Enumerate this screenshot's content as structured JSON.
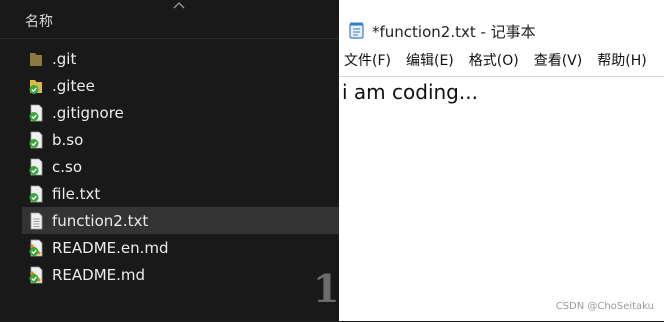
{
  "explorer": {
    "column_header": "名称",
    "files": [
      {
        "name": ".git",
        "icon": "folder-icon"
      },
      {
        "name": ".gitee",
        "icon": "folder-synced-icon"
      },
      {
        "name": ".gitignore",
        "icon": "file-synced-icon"
      },
      {
        "name": "b.so",
        "icon": "file-synced-icon"
      },
      {
        "name": "c.so",
        "icon": "file-synced-icon"
      },
      {
        "name": "file.txt",
        "icon": "file-synced-icon"
      },
      {
        "name": "function2.txt",
        "icon": "text-file-icon",
        "selected": true
      },
      {
        "name": "README.en.md",
        "icon": "markdown-file-icon"
      },
      {
        "name": "README.md",
        "icon": "markdown-file-icon"
      }
    ],
    "partial_text": "1"
  },
  "notepad": {
    "title": "*function2.txt - 记事本",
    "menu": [
      "文件(F)",
      "编辑(E)",
      "格式(O)",
      "查看(V)",
      "帮助(H)"
    ],
    "content": "i am coding..."
  },
  "watermark": "CSDN @ChoSeitaku",
  "colors": {
    "explorer_bg": "#191919",
    "selected_row": "#333333",
    "notepad_bg": "#ffffff",
    "sync_green": "#3aa53a"
  }
}
